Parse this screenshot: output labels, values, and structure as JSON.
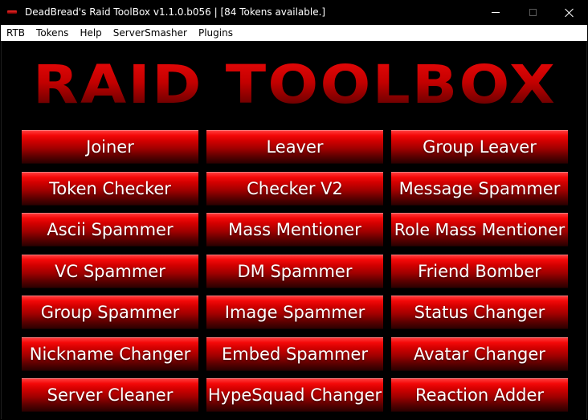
{
  "window": {
    "title": "DeadBread's Raid ToolBox v1.1.0.b056 | [84 Tokens available.]"
  },
  "menu": {
    "items": [
      "RTB",
      "Tokens",
      "Help",
      "ServerSmasher",
      "Plugins"
    ]
  },
  "logo": {
    "text": "RAID TOOLBOX"
  },
  "buttons": [
    "Joiner",
    "Leaver",
    "Group Leaver",
    "Token Checker",
    "Checker V2",
    "Message Spammer",
    "Ascii Spammer",
    "Mass Mentioner",
    "Role Mass Mentioner",
    "VC Spammer",
    "DM Spammer",
    "Friend Bomber",
    "Group Spammer",
    "Image Spammer",
    "Status Changer",
    "Nickname Changer",
    "Embed Spammer",
    "Avatar Changer",
    "Server Cleaner",
    "HypeSquad Changer",
    "Reaction Adder"
  ],
  "colors": {
    "background": "#000000",
    "button_top": "#ff3a3a",
    "button_bottom": "#2c0000",
    "logo": "#c80000",
    "menubar": "#ffffff"
  }
}
